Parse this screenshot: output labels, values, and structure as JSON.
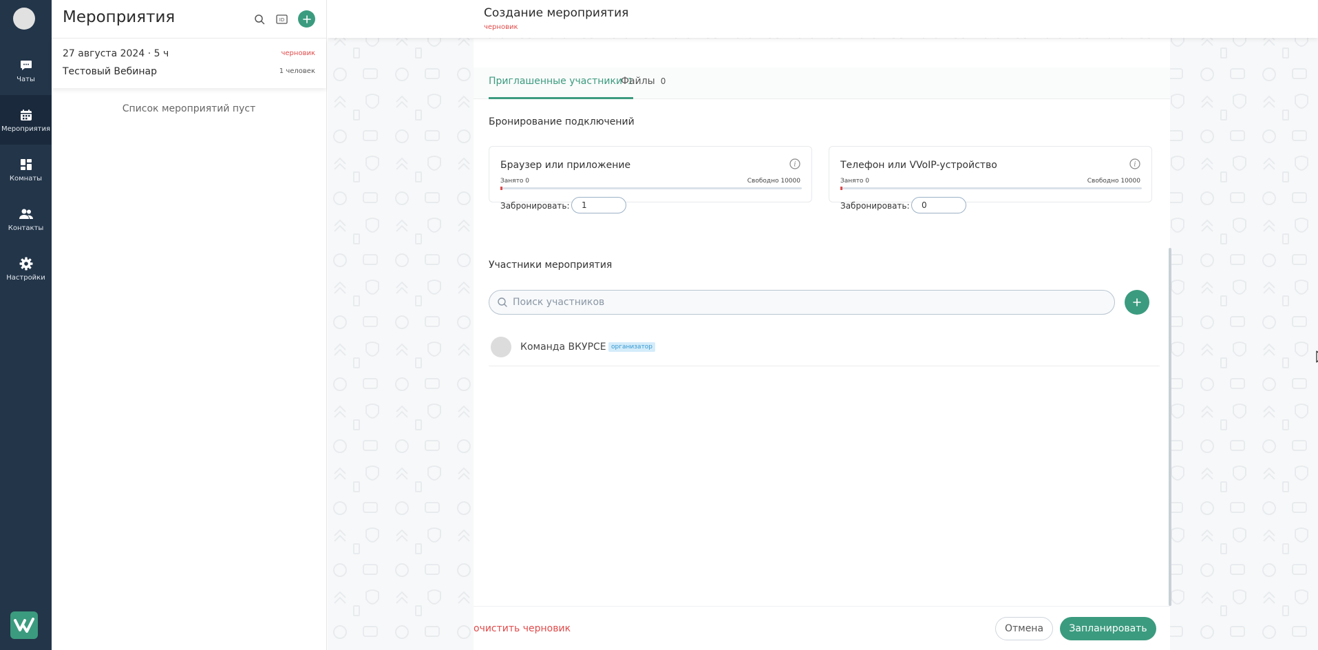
{
  "nav": {
    "items": [
      {
        "label": "Чаты",
        "icon": "chat-icon"
      },
      {
        "label": "Мероприятия",
        "icon": "calendar-icon"
      },
      {
        "label": "Комнаты",
        "icon": "rooms-icon"
      },
      {
        "label": "Контакты",
        "icon": "contacts-icon"
      },
      {
        "label": "Настройки",
        "icon": "gear-icon"
      }
    ],
    "active": "Мероприятия"
  },
  "events": {
    "title": "Мероприятия",
    "header_icons": [
      "search-icon",
      "id-icon",
      "plus-icon"
    ],
    "items": [
      {
        "date": "27 августа 2024 · 5 ч",
        "status": "черновик",
        "name": "Тестовый Вебинар",
        "count": "1 человек"
      }
    ],
    "empty_text": "Список мероприятий пуст"
  },
  "page": {
    "title": "Создание мероприятия",
    "subtitle": "черновик"
  },
  "tabs": [
    {
      "label": "Приглашенные участники",
      "count": "1",
      "active": true
    },
    {
      "label": "Файлы",
      "count": "0",
      "active": false
    }
  ],
  "booking": {
    "title": "Бронирование подключений",
    "cards": [
      {
        "title": "Браузер или приложение",
        "used": "Занято 0",
        "free": "Свободно 10000",
        "label": "Забронировать:",
        "value": "1",
        "used_fraction": 0
      },
      {
        "title": "Телефон или VVoIP-устройство",
        "used": "Занято 0",
        "free": "Свободно 10000",
        "label": "Забронировать:",
        "value": "0",
        "used_fraction": 0
      }
    ]
  },
  "participants": {
    "title": "Участники мероприятия",
    "search_placeholder": "Поиск участников",
    "items": [
      {
        "name": "Команда ВКУРСЕ",
        "role": "организатор"
      }
    ]
  },
  "footer": {
    "clear": "очистить черновик",
    "cancel": "Отмена",
    "submit": "Запланировать"
  },
  "colors": {
    "accent": "#3b9b7e",
    "nav_bg": "#233549",
    "danger": "#e04b4b",
    "role_badge": "#3498d1"
  }
}
